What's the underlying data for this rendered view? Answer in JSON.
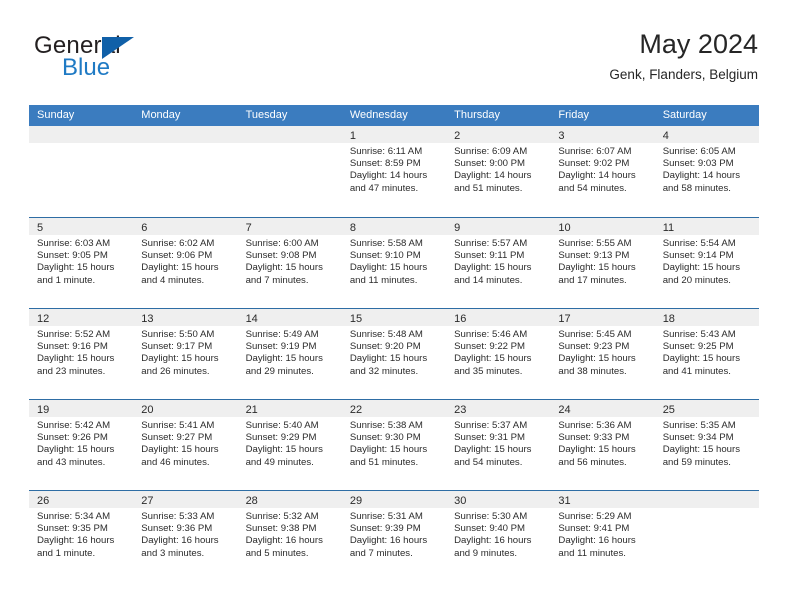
{
  "brand": {
    "name_top": "General",
    "name_bottom": "Blue",
    "triangle_color": "#1060a8",
    "blue_text_color": "#1f7ac4"
  },
  "header": {
    "title": "May 2024",
    "location": "Genk, Flanders, Belgium"
  },
  "colors": {
    "header_row_bg": "#3b7cbf",
    "row_divider": "#2e6da4",
    "day_strip_bg": "#efefef",
    "text": "#2b2b2b"
  },
  "weekdays": [
    "Sunday",
    "Monday",
    "Tuesday",
    "Wednesday",
    "Thursday",
    "Friday",
    "Saturday"
  ],
  "weeks": [
    [
      {
        "day": "",
        "empty": true,
        "sunrise": "",
        "sunset": "",
        "daylight1": "",
        "daylight2": ""
      },
      {
        "day": "",
        "empty": true,
        "sunrise": "",
        "sunset": "",
        "daylight1": "",
        "daylight2": ""
      },
      {
        "day": "",
        "empty": true,
        "sunrise": "",
        "sunset": "",
        "daylight1": "",
        "daylight2": ""
      },
      {
        "day": "1",
        "empty": false,
        "sunrise": "Sunrise: 6:11 AM",
        "sunset": "Sunset: 8:59 PM",
        "daylight1": "Daylight: 14 hours",
        "daylight2": "and 47 minutes."
      },
      {
        "day": "2",
        "empty": false,
        "sunrise": "Sunrise: 6:09 AM",
        "sunset": "Sunset: 9:00 PM",
        "daylight1": "Daylight: 14 hours",
        "daylight2": "and 51 minutes."
      },
      {
        "day": "3",
        "empty": false,
        "sunrise": "Sunrise: 6:07 AM",
        "sunset": "Sunset: 9:02 PM",
        "daylight1": "Daylight: 14 hours",
        "daylight2": "and 54 minutes."
      },
      {
        "day": "4",
        "empty": false,
        "sunrise": "Sunrise: 6:05 AM",
        "sunset": "Sunset: 9:03 PM",
        "daylight1": "Daylight: 14 hours",
        "daylight2": "and 58 minutes."
      }
    ],
    [
      {
        "day": "5",
        "empty": false,
        "sunrise": "Sunrise: 6:03 AM",
        "sunset": "Sunset: 9:05 PM",
        "daylight1": "Daylight: 15 hours",
        "daylight2": "and 1 minute."
      },
      {
        "day": "6",
        "empty": false,
        "sunrise": "Sunrise: 6:02 AM",
        "sunset": "Sunset: 9:06 PM",
        "daylight1": "Daylight: 15 hours",
        "daylight2": "and 4 minutes."
      },
      {
        "day": "7",
        "empty": false,
        "sunrise": "Sunrise: 6:00 AM",
        "sunset": "Sunset: 9:08 PM",
        "daylight1": "Daylight: 15 hours",
        "daylight2": "and 7 minutes."
      },
      {
        "day": "8",
        "empty": false,
        "sunrise": "Sunrise: 5:58 AM",
        "sunset": "Sunset: 9:10 PM",
        "daylight1": "Daylight: 15 hours",
        "daylight2": "and 11 minutes."
      },
      {
        "day": "9",
        "empty": false,
        "sunrise": "Sunrise: 5:57 AM",
        "sunset": "Sunset: 9:11 PM",
        "daylight1": "Daylight: 15 hours",
        "daylight2": "and 14 minutes."
      },
      {
        "day": "10",
        "empty": false,
        "sunrise": "Sunrise: 5:55 AM",
        "sunset": "Sunset: 9:13 PM",
        "daylight1": "Daylight: 15 hours",
        "daylight2": "and 17 minutes."
      },
      {
        "day": "11",
        "empty": false,
        "sunrise": "Sunrise: 5:54 AM",
        "sunset": "Sunset: 9:14 PM",
        "daylight1": "Daylight: 15 hours",
        "daylight2": "and 20 minutes."
      }
    ],
    [
      {
        "day": "12",
        "empty": false,
        "sunrise": "Sunrise: 5:52 AM",
        "sunset": "Sunset: 9:16 PM",
        "daylight1": "Daylight: 15 hours",
        "daylight2": "and 23 minutes."
      },
      {
        "day": "13",
        "empty": false,
        "sunrise": "Sunrise: 5:50 AM",
        "sunset": "Sunset: 9:17 PM",
        "daylight1": "Daylight: 15 hours",
        "daylight2": "and 26 minutes."
      },
      {
        "day": "14",
        "empty": false,
        "sunrise": "Sunrise: 5:49 AM",
        "sunset": "Sunset: 9:19 PM",
        "daylight1": "Daylight: 15 hours",
        "daylight2": "and 29 minutes."
      },
      {
        "day": "15",
        "empty": false,
        "sunrise": "Sunrise: 5:48 AM",
        "sunset": "Sunset: 9:20 PM",
        "daylight1": "Daylight: 15 hours",
        "daylight2": "and 32 minutes."
      },
      {
        "day": "16",
        "empty": false,
        "sunrise": "Sunrise: 5:46 AM",
        "sunset": "Sunset: 9:22 PM",
        "daylight1": "Daylight: 15 hours",
        "daylight2": "and 35 minutes."
      },
      {
        "day": "17",
        "empty": false,
        "sunrise": "Sunrise: 5:45 AM",
        "sunset": "Sunset: 9:23 PM",
        "daylight1": "Daylight: 15 hours",
        "daylight2": "and 38 minutes."
      },
      {
        "day": "18",
        "empty": false,
        "sunrise": "Sunrise: 5:43 AM",
        "sunset": "Sunset: 9:25 PM",
        "daylight1": "Daylight: 15 hours",
        "daylight2": "and 41 minutes."
      }
    ],
    [
      {
        "day": "19",
        "empty": false,
        "sunrise": "Sunrise: 5:42 AM",
        "sunset": "Sunset: 9:26 PM",
        "daylight1": "Daylight: 15 hours",
        "daylight2": "and 43 minutes."
      },
      {
        "day": "20",
        "empty": false,
        "sunrise": "Sunrise: 5:41 AM",
        "sunset": "Sunset: 9:27 PM",
        "daylight1": "Daylight: 15 hours",
        "daylight2": "and 46 minutes."
      },
      {
        "day": "21",
        "empty": false,
        "sunrise": "Sunrise: 5:40 AM",
        "sunset": "Sunset: 9:29 PM",
        "daylight1": "Daylight: 15 hours",
        "daylight2": "and 49 minutes."
      },
      {
        "day": "22",
        "empty": false,
        "sunrise": "Sunrise: 5:38 AM",
        "sunset": "Sunset: 9:30 PM",
        "daylight1": "Daylight: 15 hours",
        "daylight2": "and 51 minutes."
      },
      {
        "day": "23",
        "empty": false,
        "sunrise": "Sunrise: 5:37 AM",
        "sunset": "Sunset: 9:31 PM",
        "daylight1": "Daylight: 15 hours",
        "daylight2": "and 54 minutes."
      },
      {
        "day": "24",
        "empty": false,
        "sunrise": "Sunrise: 5:36 AM",
        "sunset": "Sunset: 9:33 PM",
        "daylight1": "Daylight: 15 hours",
        "daylight2": "and 56 minutes."
      },
      {
        "day": "25",
        "empty": false,
        "sunrise": "Sunrise: 5:35 AM",
        "sunset": "Sunset: 9:34 PM",
        "daylight1": "Daylight: 15 hours",
        "daylight2": "and 59 minutes."
      }
    ],
    [
      {
        "day": "26",
        "empty": false,
        "sunrise": "Sunrise: 5:34 AM",
        "sunset": "Sunset: 9:35 PM",
        "daylight1": "Daylight: 16 hours",
        "daylight2": "and 1 minute."
      },
      {
        "day": "27",
        "empty": false,
        "sunrise": "Sunrise: 5:33 AM",
        "sunset": "Sunset: 9:36 PM",
        "daylight1": "Daylight: 16 hours",
        "daylight2": "and 3 minutes."
      },
      {
        "day": "28",
        "empty": false,
        "sunrise": "Sunrise: 5:32 AM",
        "sunset": "Sunset: 9:38 PM",
        "daylight1": "Daylight: 16 hours",
        "daylight2": "and 5 minutes."
      },
      {
        "day": "29",
        "empty": false,
        "sunrise": "Sunrise: 5:31 AM",
        "sunset": "Sunset: 9:39 PM",
        "daylight1": "Daylight: 16 hours",
        "daylight2": "and 7 minutes."
      },
      {
        "day": "30",
        "empty": false,
        "sunrise": "Sunrise: 5:30 AM",
        "sunset": "Sunset: 9:40 PM",
        "daylight1": "Daylight: 16 hours",
        "daylight2": "and 9 minutes."
      },
      {
        "day": "31",
        "empty": false,
        "sunrise": "Sunrise: 5:29 AM",
        "sunset": "Sunset: 9:41 PM",
        "daylight1": "Daylight: 16 hours",
        "daylight2": "and 11 minutes."
      },
      {
        "day": "",
        "empty": true,
        "sunrise": "",
        "sunset": "",
        "daylight1": "",
        "daylight2": ""
      }
    ]
  ]
}
